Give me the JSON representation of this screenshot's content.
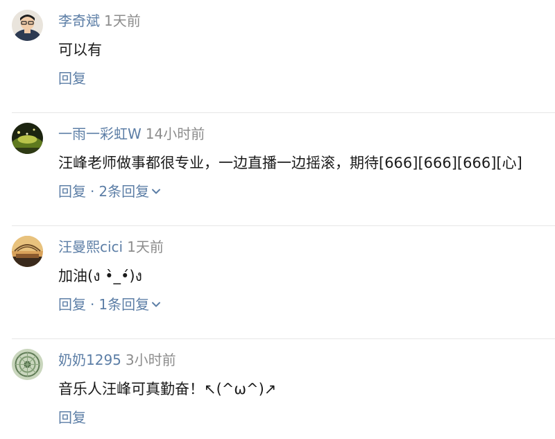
{
  "comments": [
    {
      "username": "李奇斌",
      "time": "1天前",
      "text": "可以有",
      "reply_label": "回复",
      "replies_label": ""
    },
    {
      "username": "一雨一彩虹W",
      "time": "14小时前",
      "text": "汪峰老师做事都很专业，一边直播一边摇滚，期待[666][666][666][心]",
      "reply_label": "回复",
      "separator": "·",
      "replies_label": "2条回复"
    },
    {
      "username": "汪曼熙cici",
      "time": "1天前",
      "text": "加油(ง •̀_•́)ง",
      "reply_label": "回复",
      "separator": "·",
      "replies_label": "1条回复"
    },
    {
      "username": "奶奶1295",
      "time": "3小时前",
      "text": "音乐人汪峰可真勤奋！↖(^ω^)↗",
      "reply_label": "回复",
      "replies_label": ""
    }
  ],
  "colors": {
    "link": "#5c7ea6",
    "meta_time": "#8c8c8c",
    "text": "#1a1a1a",
    "divider": "#e6e6e6"
  },
  "icons": {
    "expand": "chevron-down-icon"
  }
}
